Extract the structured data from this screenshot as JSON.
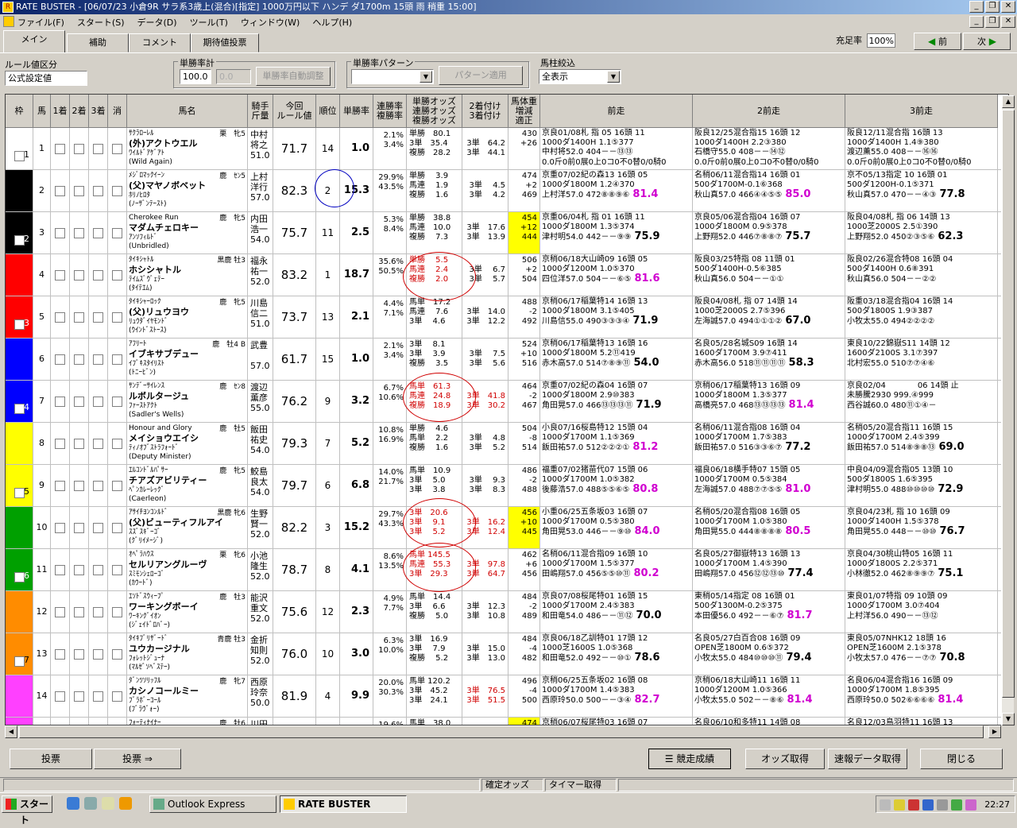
{
  "window": {
    "title": "RATE BUSTER - [06/07/23 小倉9R サラ系3歳上(混合)[指定] 1000万円以下 ハンデ ダ1700m 15頭 雨 稍重 15:00]"
  },
  "menu": [
    "ファイル(F)",
    "スタート(S)",
    "データ(D)",
    "ツール(T)",
    "ウィンドウ(W)",
    "ヘルプ(H)"
  ],
  "tabs": [
    "メイン",
    "補助",
    "コメント",
    "期待値投票"
  ],
  "fill_rate": {
    "label": "充足率",
    "value": "100%"
  },
  "nav": {
    "prev": "前",
    "next": "次"
  },
  "controls": {
    "rule_label": "ルール値区分",
    "rule_value": "公式設定値",
    "winrate_label": "単勝率計",
    "winrate_value": "100.0",
    "winrate_value2": "0.0",
    "winrate_button": "単勝率自動調整",
    "pattern_label": "単勝率パターン",
    "pattern_button": "パターン適用",
    "filter_label": "馬柱絞込",
    "filter_value": "全表示"
  },
  "headers": [
    "枠",
    "馬",
    "1着",
    "2着",
    "3着",
    "消",
    "馬名",
    "騎手\n斤量",
    "今回\nルール値",
    "順位",
    "単勝率",
    "連勝率\n複勝率",
    "単勝オッズ\n連勝オッズ\n複勝オッズ",
    "2着付け\n3着付け",
    "馬体重\n増減\n適正",
    "前走",
    "2前走",
    "3前走"
  ],
  "rows": [
    {
      "waku": "1",
      "num": "1",
      "sire": "ｻｸﾗﾛｰﾚﾙ",
      "sex": "栗　牝5",
      "name": "(外)アクトウエル",
      "dam": "ﾜｲﾙﾄﾞｱｹﾞｱﾄ",
      "dam2": "(Wild Again)",
      "jockey": "中村\n将之\n51.0",
      "rule": "71.7",
      "rank": "14",
      "win": "1.0",
      "rate": "2.1%\n3.4%",
      "odds": "単勝　80.1\n3単　35.4\n複勝　28.2",
      "odds2": "3単　64.2\n3単　44.1",
      "bw": "430\n+26\n",
      "bwy": false,
      "p1": "京良01/08札 指 05 16頭 11\n1000ダ1400H 1.1⑤377\n中村将52.0 404－－⑬⑬\n0.0斤0前0展0上0コ0不0替0/0騎0",
      "p1s": "",
      "p2": "阪良12/25混合指15 16頭 12\n1000ダ1400H 2.2③380\n石橋守55.0 408－－⑭⑫\n0.0斤0前0展0上0コ0不0替0/0騎0",
      "p2s": "",
      "p3": "阪良12/11混合指 16頭 13\n1000ダ1400H 1.4⑨380\n渡辺薫55.0 408－－⑯⑯\n0.0斤0前0展0上0コ0不0替0/0騎0",
      "p3s": ""
    },
    {
      "waku": "2",
      "num": "2",
      "sire": "ﾒｼﾞﾛﾏｯｸｲｰﾝ",
      "sex": "鹿　ｾﾝ5",
      "name": "(父)マヤノボベット",
      "dam": "ﾎﾘﾉﾋﾛﾀ",
      "dam2": "(ﾉｰｻﾞﾝﾃｰｽﾄ)",
      "jockey": "上村\n洋行\n57.0",
      "rule": "82.3",
      "rank": "2",
      "win": "15.3",
      "rate": "29.9%\n43.5%",
      "odds": "単勝　 3.9\n馬連　 1.9\n複勝　 1.6",
      "odds2": "3単　 4.5\n3単　 4.2",
      "bw": "474\n+2\n469",
      "bwy": false,
      "p1": "京重07/02紀の森13 16頭 05\n1000ダ1800M 1.2④370\n上村洋57.0 472⑧⑧⑨⑥",
      "p1s": "81.4",
      "p2": "名稍06/11混合指14 16頭 01\n500ダ1700M-0.1⑥368\n秋山真57.0 466④④⑤⑤",
      "p2s": "85.0",
      "p3": "京不05/13指定 10 16頭 01\n500ダ1200H-0.1⑤371\n秋山真57.0 470－－④③",
      "p3s": "77.8"
    },
    {
      "waku": "2",
      "num": "3",
      "sire": "Cherokee Run",
      "sex": "鹿　牝5",
      "name": "マダムチェロキー",
      "dam": "ｱﾝｿﾌｨﾙﾄﾞ",
      "dam2": "(Unbridled)",
      "jockey": "内田\n浩一\n54.0",
      "rule": "75.7",
      "rank": "11",
      "win": "2.5",
      "rate": "5.3%\n8.4%",
      "odds": "単勝　38.8\n馬連　10.0\n複勝　 7.3",
      "odds2": "3単　17.6\n3単　13.9",
      "bw": "454\n+12\n444",
      "bwy": true,
      "p1": "京重06/04札 指 01 16頭 11\n1000ダ1800M 1.3⑤374\n津村明54.0 442－－⑨⑨",
      "p1s": "75.9",
      "p2": "京良05/06混合指04 16頭 07\n1000ダ1800M 0.9⑤378\n上野翔52.0 446⑦⑧⑧⑦",
      "p2s": "75.7",
      "p3": "阪良04/08札 指 06 14頭 13\n1000芝2000S 2.5①390\n上野翔52.0 450②③⑤⑥",
      "p3s": "62.3"
    },
    {
      "waku": "3",
      "num": "4",
      "sire": "ﾀｲｷｼｬﾄﾙ",
      "sex": "黒鹿 牡3",
      "name": "ホシシャトル",
      "dam": "ﾃｲﾑｽﾞｳﾞｪﾃｰ",
      "dam2": "(ﾀｲﾃｴﾑ)",
      "jockey": "福永\n祐一\n52.0",
      "rule": "83.2",
      "rank": "1",
      "win": "18.7",
      "rate": "35.6%\n50.5%",
      "odds": "単勝　 5.5\n馬連　 2.4\n複勝　 2.0",
      "odds2": "3単　 6.7\n3単　 5.7",
      "bw": "506\n+2\n504",
      "bwy": false,
      "p1": "京稍06/18大山崎09 16頭 05\n1000ダ1200M 1.0⑤370\n四位洋57.0 504－－⑥⑤",
      "p1s": "81.6",
      "p2": "阪良03/25特指 08 11頭 01\n500ダ1400H-0.5⑥385\n秋山真56.0 504－－①①",
      "p2s": "",
      "p3": "阪良02/26混合特08 16頭 04\n500ダ1400H 0.6⑧391\n秋山真56.0 504－－②②",
      "p3s": ""
    },
    {
      "waku": "3",
      "num": "5",
      "sire": "ﾀｲｷｼｬｰﾛｯｸ",
      "sex": "鹿　牝5",
      "name": "(父)リュウヨウ",
      "dam": "ﾘｭｳﾀﾞｲﾔﾓﾝﾄﾞ",
      "dam2": "(ｳｲﾝﾄﾞｽﾄｰｽ)",
      "jockey": "川島\n信二\n51.0",
      "rule": "73.7",
      "rank": "13",
      "win": "2.1",
      "rate": "4.4%\n7.1%",
      "odds": "馬単　17.2\n馬連　 7.6\n3単　 4.6",
      "odds2": "3単　14.0\n3単　12.2",
      "bw": "488\n-2\n492",
      "bwy": false,
      "p1": "京稍06/17稲葉特14 16頭 13\n1000ダ1800M 3.1⑤405\n川島信55.0 490③③③④",
      "p1s": "71.9",
      "p2": "阪良04/08札 指 07 14頭 14\n1000芝2000S 2.7⑤396\n左海誠57.0 494①①①②",
      "p2s": "67.0",
      "p3": "阪重03/18混合指04 16頭 14\n500ダ1800S 1.9③387\n小牧太55.0 494②②②②",
      "p3s": ""
    },
    {
      "waku": "4",
      "num": "6",
      "sire": "ｱﾌﾘｰﾄ",
      "sex": "鹿　牡4 B",
      "name": "イブキサブデュー",
      "dam": "ｲﾌﾞｷｽﾀｲﾘｽﾄ",
      "dam2": "(ﾄﾆｰﾋﾞﾝ)",
      "jockey": "武豊\n\n57.0",
      "rule": "61.7",
      "rank": "15",
      "win": "1.0",
      "rate": "2.1%\n3.4%",
      "odds": "3単　 8.1\n3単　 3.9\n複勝　 3.5",
      "odds2": "3単　 7.5\n3単　 5.6",
      "bw": "524\n+10\n516",
      "bwy": false,
      "p1": "京稍06/17稲葉特13 16頭 16\n1000ダ1800M 5.2⑪419\n赤木高57.0 514⑦⑧⑨⑪",
      "p1s": "54.0",
      "p2": "名良05/28名城S09 16頭 14\n1600ダ1700M 3.9⑦411\n赤木高56.0 518⑪⑪⑪⑪",
      "p2s": "58.3",
      "p3": "東良10/22錦嶽S11 14頭 12\n1600ダ2100S 3.1⑦397\n北村宏55.0 510⑦⑦④⑥",
      "p3s": ""
    },
    {
      "waku": "4",
      "num": "7",
      "sire": "ｻﾝﾃﾞｰｻｲﾚﾝｽ",
      "sex": "鹿　ｾﾝ8",
      "name": "ルボルタージュ",
      "dam": "ﾌｧｰｽﾄｱｸﾄ",
      "dam2": "(Sadler's Wells)",
      "jockey": "渡辺\n薫彦\n55.0",
      "rule": "76.2",
      "rank": "9",
      "win": "3.2",
      "rate": "6.7%\n10.6%",
      "odds": "馬単　61.3\n馬連　24.8\n複勝　18.9",
      "odds2": "3単　41.8\n3単　30.2",
      "bw": "464\n-2\n467",
      "bwy": false,
      "p1": "京重07/02紀の森04 16頭 07\n1000ダ1800M 2.9⑩383\n角田晃57.0 466⑬⑬⑬⑪",
      "p1s": "71.9",
      "p2": "京稍06/17稲葉特13 16頭 09\n1000ダ1800M 1.3⑤377\n高橋亮57.0 468⑬⑬⑬⑬",
      "p2s": "81.4",
      "p3": "京良02/04　　　　06 14頭 止\n未勝騰2930 999.④999\n西谷誠60.0 480⑪①④－",
      "p3s": ""
    },
    {
      "waku": "5",
      "num": "8",
      "sire": "Honour and Glory",
      "sex": "鹿　牡5",
      "name": "メイショウエイシ",
      "dam": "ﾃｨﾉｵﾌﾞｽﾄﾗﾌｫｰﾄﾞ",
      "dam2": "(Deputy Minister)",
      "jockey": "飯田\n祐史\n54.0",
      "rule": "79.3",
      "rank": "7",
      "win": "5.2",
      "rate": "10.8%\n16.9%",
      "odds": "単勝　 4.6\n馬単　 2.2\n複勝　 1.6",
      "odds2": "3単　 4.8\n3単　 5.2",
      "bw": "504\n-8\n514",
      "bwy": false,
      "p1": "小良07/16桜島特12 15頭 04\n1000ダ1700M 1.1⑤369\n飯田祐57.0 512②②②①",
      "p1s": "81.2",
      "p2": "名稍06/11混合指08 16頭 04\n1000ダ1700M 1.7⑤383\n飯田祐57.0 516③③⑥⑦",
      "p2s": "77.2",
      "p3": "名稍05/20混合指11 16頭 15\n1000ダ1700M 2.4⑤399\n飯田祐57.0 514⑧⑨⑧⑬",
      "p3s": "69.0"
    },
    {
      "waku": "5",
      "num": "9",
      "sire": "ｴﾙｺﾝﾄﾞﾙﾊﾟｻｰ",
      "sex": "鹿　牝5",
      "name": "チアズアビリティー",
      "dam": "ﾍﾟﾝｶﾚｰﾚｯｸﾞ",
      "dam2": "(Caerleon)",
      "jockey": "鮫島\n良太\n54.0",
      "rule": "79.7",
      "rank": "6",
      "win": "6.8",
      "rate": "14.0%\n21.7%",
      "odds": "馬単　10.9\n3単　 5.0\n3単　 3.8",
      "odds2": "3単　 9.3\n3単　 8.3",
      "bw": "486\n-2\n488",
      "bwy": false,
      "p1": "福重07/02猪苗代07 15頭 06\n1000ダ1700M 1.0⑤382\n後藤浩57.0 488⑤⑤⑥⑤",
      "p1s": "80.8",
      "p2": "福良06/18横手特07 15頭 05\n1000ダ1700M 0.5⑤384\n左海誠57.0 488⑦⑦⑤⑤",
      "p2s": "81.0",
      "p3": "中良04/09混合指05 13頭 10\n500ダ1800S 1.6⑤395\n津村明55.0 488⑩⑩⑩⑩",
      "p3s": "72.9"
    },
    {
      "waku": "6",
      "num": "10",
      "sire": "ｱｻｲﾁﾖﾝｺﾝﾙﾄﾞ",
      "sex": "黒鹿 牝6",
      "name": "(父)ビューティフルアイ",
      "dam": "ｽｽﾞｽｷﾞｰｺﾞ",
      "dam2": "(ｸﾞﾘｲﾒｰｼﾞ)",
      "jockey": "生野\n賢一\n52.0",
      "rule": "82.2",
      "rank": "3",
      "win": "15.2",
      "rate": "29.7%\n43.3%",
      "odds": "3単　20.6\n3単　 9.1\n3単　 5.2",
      "odds2": "3単　16.2\n3単　12.4",
      "bw": "456\n+10\n445",
      "bwy": true,
      "p1": "小重06/25五条坂03 16頭 07\n1000ダ1700M 0.5⑤380\n角田晃53.0 446－－⑨⑩",
      "p1s": "84.0",
      "p2": "名稍05/20混合指08 16頭 05\n1000ダ1700M 1.0⑤380\n角田晃55.0 444⑧⑧⑧⑧",
      "p2s": "80.5",
      "p3": "京良04/23札 指 10 16頭 09\n1000ダ1400H 1.5⑤378\n角田晃55.0 448－－⑩⑩",
      "p3s": "76.7"
    },
    {
      "waku": "6",
      "num": "11",
      "sire": "ｵﾍﾟﾗﾊｳｽ",
      "sex": "栗　牝6",
      "name": "セルリアングルーヴ",
      "dam": "ｽﾐﾓﾝｼｪﾛｰｺﾞ",
      "dam2": "(ｶｳｰﾄﾞ)",
      "jockey": "小池\n隆生\n52.0",
      "rule": "78.7",
      "rank": "8",
      "win": "4.1",
      "rate": "8.6%\n13.5%",
      "odds": "馬単 145.5\n馬連　55.3\n3単　29.3",
      "odds2": "3単　97.8\n3単　64.7",
      "bw": "462\n+6\n456",
      "bwy": false,
      "p1": "名稍06/11混合指09 16頭 10\n1000ダ1700M 1.5⑤377\n田嶋翔57.0 456⑤⑤⑩⑪",
      "p1s": "80.2",
      "p2": "名良05/27御嶽特13 16頭 13\n1000ダ1700M 1.4⑤390\n田嶋翔57.0 456⑫⑫⑬⑩",
      "p2s": "77.4",
      "p3": "京良04/30桃山特05 16頭 11\n1000ダ1800S 2.2⑤371\n小林徹52.0 462⑧⑨⑨⑦",
      "p3s": "75.1"
    },
    {
      "waku": "7",
      "num": "12",
      "sire": "ｴｿﾄﾞｽｳｨｰﾌﾟ",
      "sex": "鹿　牡3",
      "name": "ワーキングボーイ",
      "dam": "ﾜｰｷﾝｸﾞｲｵﾝ",
      "dam2": "(ｼﾞｪｲﾄﾞﾛﾊﾞｰ)",
      "jockey": "能沢\n重文\n52.0",
      "rule": "75.6",
      "rank": "12",
      "win": "2.3",
      "rate": "4.9%\n7.7%",
      "odds": "馬単　14.4\n3単　 6.6\n複勝　 5.0",
      "odds2": "3単　12.3\n3単　10.8",
      "bw": "484\n-2\n489",
      "bwy": false,
      "p1": "京良07/08桜尾特01 16頭 15\n1000ダ1700M 2.4⑤383\n和田竜54.0 486－－⑪⑫",
      "p1s": "70.0",
      "p2": "東稍05/14指定 08 16頭 01\n500ダ1300M-0.2⑤375\n本田優56.0 492－－⑥⑦",
      "p2s": "81.7",
      "p3": "東良01/07特指 09 10頭 09\n1000ダ1700M 3.0⑦404\n上村洋56.0 490－－⑬⑫",
      "p3s": ""
    },
    {
      "waku": "7",
      "num": "13",
      "sire": "ﾀｲｷﾌﾞﾘｻﾞｰﾄﾞ",
      "sex": "青鹿 牡3",
      "name": "ユウカージナル",
      "dam": "ﾌｫﾚｯﾄｼﾞｭｰﾅ",
      "dam2": "(ﾏﾙｾﾞｿﾍﾞｽﾃｰ)",
      "jockey": "金折\n知則\n52.0",
      "rule": "76.0",
      "rank": "10",
      "win": "3.0",
      "rate": "6.3%\n10.0%",
      "odds": "3単　16.9\n3単　 7.9\n複勝　 5.2",
      "odds2": "3単　15.0\n3単　13.0",
      "bw": "484\n-4\n482",
      "bwy": false,
      "p1": "京良06/18乙訓特01 17頭 12\n1000芝1600S 1.0⑤368\n和田竜52.0 492－－⑩①",
      "p1s": "78.6",
      "p2": "名良05/27白百合08 16頭 09\nOPEN芝1800M 0.6⑤372\n小牧太55.0 484⑩⑩⑩⑪",
      "p2s": "79.4",
      "p3": "東良05/07NHK12 18頭 16\nOPEN芝1600M 2.1⑤378\n小牧太57.0 476－－⑦⑦",
      "p3s": "70.8"
    },
    {
      "waku": "8",
      "num": "14",
      "sire": "ﾀﾞﾝﾂｿﾘｯﾌﾙ",
      "sex": "鹿　牝7",
      "name": "カシノコールミー",
      "dam": "ﾌﾞﾗﾎﾞｰｺｰﾙ",
      "dam2": "(ﾌﾞﾗｳﾞｫｰ)",
      "jockey": "西原\n玲奈\n50.0",
      "rule": "81.9",
      "rank": "4",
      "win": "9.9",
      "rate": "20.0%\n30.3%",
      "odds": "馬単 120.2\n3単　45.2\n3単　24.1",
      "odds2": "3単　76.5\n3単　51.5",
      "bw": "496\n-4\n500",
      "bwy": false,
      "p1": "京稍06/25五条坂02 16頭 08\n1000ダ1700M 1.4⑤383\n西原玲50.0 500－－③④",
      "p1s": "82.7",
      "p2": "京稍06/18大山崎11 16頭 11\n1000ダ1200M 1.0⑤366\n小牧太55.0 502－－⑧⑥",
      "p2s": "81.4",
      "p3": "名良06/04混合指16 16頭 09\n1000ダ1700M 1.8⑤395\n西原玲50.0 502⑥⑥⑥⑥",
      "p3s": "81.4"
    },
    {
      "waku": "8",
      "num": "15",
      "sire": "ﾌｫｰﾃｨﾅｲﾅｰ",
      "sex": "鹿　牡6",
      "name": "",
      "dam": "",
      "dam2": "",
      "jockey": "川田\n\n",
      "rule": "",
      "rank": "",
      "win": "",
      "rate": "19.6%\n",
      "odds": "馬単　38.0\n\n",
      "odds2": "\n",
      "bw": "474\n\n",
      "bwy": true,
      "p1": "京稍06/07桜尾特03 16頭 07\n\n",
      "p1s": "",
      "p2": "名良06/10和多特11 14頭 08\n\n",
      "p2s": "",
      "p3": "名良12/03鳥羽特11 16頭 13\n\n",
      "p3s": ""
    }
  ],
  "waku_colors": {
    "1": "#ffffff",
    "2": "#000000",
    "3": "#ff0000",
    "4": "#0000ff",
    "5": "#ffff00",
    "6": "#00a000",
    "7": "#ff8c00",
    "8": "#ff40ff"
  },
  "bottom_buttons": {
    "vote": "投票",
    "vote2": "投票 ⇒",
    "results": "競走成績",
    "odds": "オッズ取得",
    "data": "速報データ取得",
    "close": "閉じる"
  },
  "status": {
    "confirmed": "確定オッズ",
    "timer": "タイマー取得"
  },
  "taskbar": {
    "start": "スタート",
    "app1": "Outlook Express",
    "app2": "RATE BUSTER",
    "time": "22:27"
  }
}
